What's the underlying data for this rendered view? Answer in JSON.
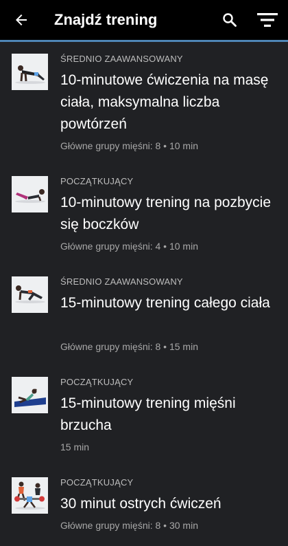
{
  "header": {
    "title": "Znajdź trening",
    "back_icon": "arrow-left-icon",
    "search_icon": "search-icon",
    "filter_icon": "filter-icon"
  },
  "colors": {
    "background": "#202124",
    "toolbar": "#000000",
    "accent": "#4f86b6",
    "text_primary": "#ffffff",
    "text_secondary": "#a8a8a8"
  },
  "workouts": [
    {
      "level": "ŚREDNIO ZAAWANSOWANY",
      "title": "10-minutowe ćwiczenia na masę ciała, maksymalna liczba powtórzeń",
      "meta": "Główne grupy mięśni: 8 • 10 min"
    },
    {
      "level": "POCZĄTKUJĄCY",
      "title": "10-minutowy trening na pozbycie się boczków",
      "meta": "Główne grupy mięśni: 4 • 10 min"
    },
    {
      "level": "ŚREDNIO ZAAWANSOWANY",
      "title": "15-minutowy trening całego ciała",
      "meta": "Główne grupy mięśni: 8 • 15 min"
    },
    {
      "level": "POCZĄTKUJĄCY",
      "title": "15-minutowy trening mięśni brzucha",
      "meta": "15 min"
    },
    {
      "level": "POCZĄTKUJĄCY",
      "title": "30 minut ostrych ćwiczeń",
      "meta": "Główne grupy mięśni: 8 • 30 min"
    }
  ]
}
